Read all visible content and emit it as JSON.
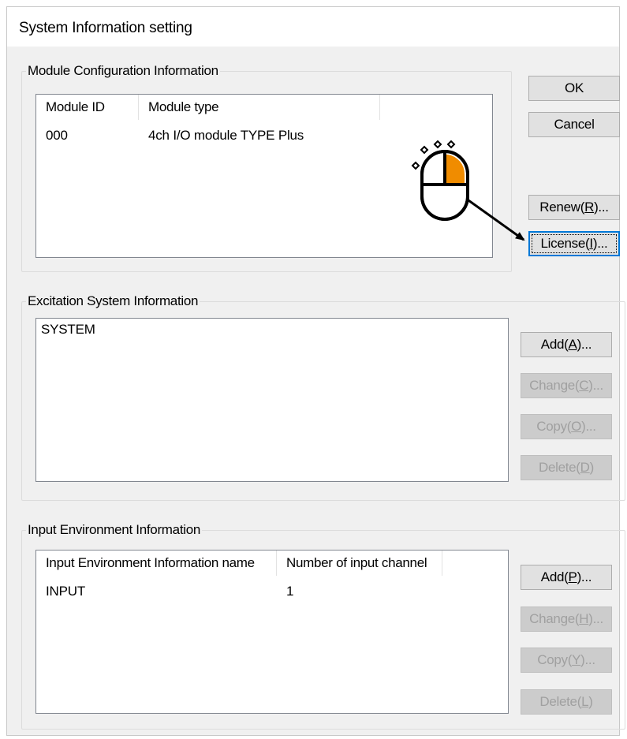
{
  "dialog": {
    "title": "System Information setting"
  },
  "module_config": {
    "legend": "Module Configuration Information",
    "columns": [
      "Module ID",
      "Module type"
    ],
    "rows": [
      {
        "id": "000",
        "type": "4ch I/O module TYPE Plus"
      }
    ]
  },
  "buttons": {
    "ok": "OK",
    "cancel": "Cancel",
    "renew": {
      "text": "Renew(",
      "key": "R",
      "tail": ")..."
    },
    "license": {
      "text": "License(",
      "key": "I",
      "tail": ")..."
    }
  },
  "excitation": {
    "legend": "Excitation System Information",
    "items": [
      "SYSTEM"
    ],
    "add": {
      "text": "Add(",
      "key": "A",
      "tail": ")..."
    },
    "change": {
      "text": "Change(",
      "key": "C",
      "tail": ")..."
    },
    "copy": {
      "text": "Copy(",
      "key": "O",
      "tail": ")..."
    },
    "delete": {
      "text": "Delete(",
      "key": "D",
      "tail": ")"
    }
  },
  "input_env": {
    "legend": "Input Environment Information",
    "columns": [
      "Input Environment Information name",
      "Number of input channel"
    ],
    "rows": [
      {
        "name": "INPUT",
        "channels": "1"
      }
    ],
    "add": {
      "text": "Add(",
      "key": "P",
      "tail": ")..."
    },
    "change": {
      "text": "Change(",
      "key": "H",
      "tail": ")..."
    },
    "copy": {
      "text": "Copy(",
      "key": "Y",
      "tail": ")..."
    },
    "delete": {
      "text": "Delete(",
      "key": "L",
      "tail": ")"
    }
  },
  "annotation": {
    "icon": "mouse-click-icon",
    "highlight_color": "#f08c00"
  }
}
